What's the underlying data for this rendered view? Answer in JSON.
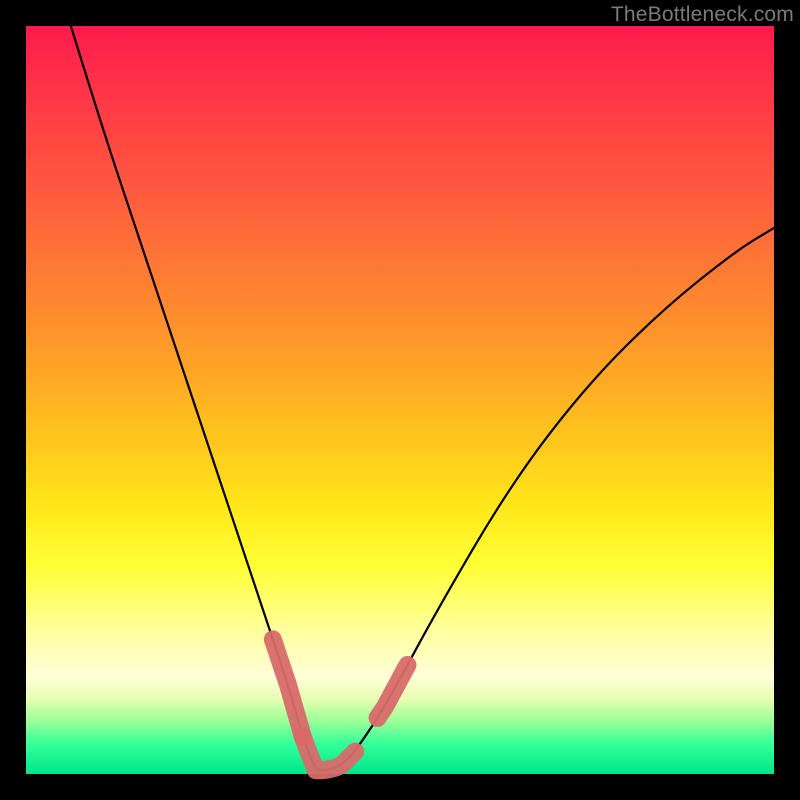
{
  "watermark": "TheBottleneck.com",
  "chart_data": {
    "type": "line",
    "title": "",
    "xlabel": "",
    "ylabel": "",
    "xlim": [
      0,
      100
    ],
    "ylim": [
      0,
      100
    ],
    "series": [
      {
        "name": "bottleneck-curve",
        "x": [
          6,
          10,
          15,
          20,
          25,
          28,
          32,
          35,
          37,
          38.7,
          40,
          42,
          44,
          48,
          55,
          65,
          75,
          85,
          95,
          100
        ],
        "y": [
          100,
          87,
          72,
          57,
          42,
          33,
          21,
          12,
          5,
          0.5,
          0.5,
          1,
          3,
          9,
          22,
          39,
          52,
          62,
          70,
          73
        ]
      }
    ],
    "highlight_ranges": [
      {
        "name": "left-marker",
        "x_start": 33,
        "x_end": 37
      },
      {
        "name": "bottom-marker",
        "x_start": 37,
        "x_end": 44
      },
      {
        "name": "right-marker",
        "x_start": 47,
        "x_end": 51
      }
    ]
  }
}
